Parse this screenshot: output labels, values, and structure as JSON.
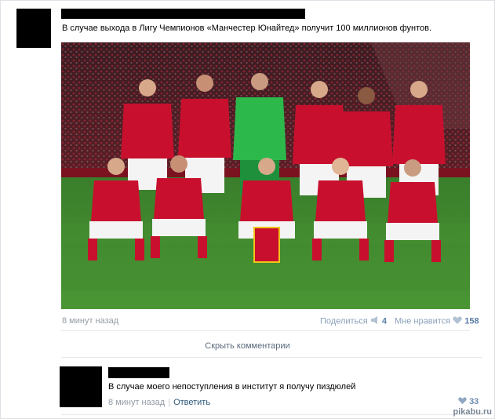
{
  "post": {
    "text": "В случае выхода в Лигу Чемпионов «Манчестер Юнайтед» получит 100 миллионов фунтов.",
    "time": "8 минут назад",
    "share_label": "Поделиться",
    "share_count": "4",
    "like_label": "Мне нравится",
    "like_count": "158",
    "hide_comments": "Скрыть комментарии"
  },
  "comment": {
    "text": "В случае моего непоступления в институт я получу пиздюлей",
    "time": "8 минут назад",
    "reply_label": "Ответить",
    "like_count": "33"
  },
  "watermark": "pikabu.ru",
  "icons": {
    "share": "megaphone-icon",
    "like": "heart-icon",
    "comment_like": "heart-icon"
  },
  "colors": {
    "link": "#2b587a",
    "meta": "#939ba6",
    "kit_red": "#c8102e",
    "keeper_green": "#2db84b",
    "pitch": "#3f8a2e"
  }
}
